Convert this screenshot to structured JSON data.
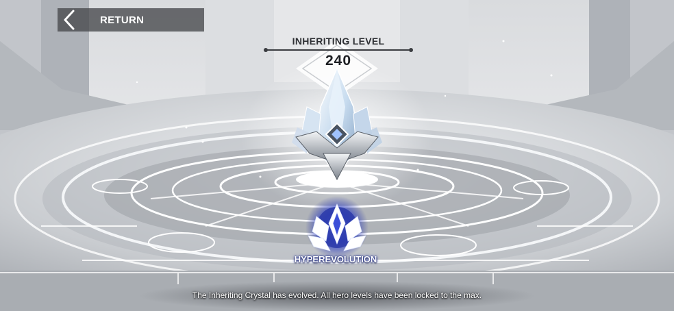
{
  "nav": {
    "return_label": "RETURN",
    "back_icon": "chevron-left-icon"
  },
  "level": {
    "title": "INHERITING LEVEL",
    "value": "240"
  },
  "emblem": {
    "label": "HYPEREVOLUTION",
    "icon": "hyperevolution-emblem-icon",
    "glow_color": "#3b4fd8"
  },
  "crystal": {
    "icon": "inheriting-crystal-icon"
  },
  "message": "The Inheriting Crystal has evolved. All hero levels have been locked to the max.",
  "colors": {
    "scene_light": "#e6e8ea",
    "scene_mid": "#b9bcc1",
    "scene_dark": "#8e9298",
    "panel": "#46484c"
  }
}
